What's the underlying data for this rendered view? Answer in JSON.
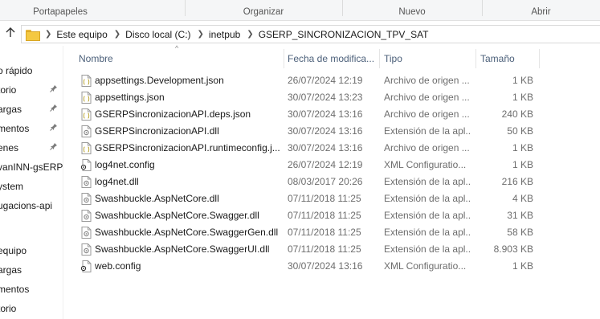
{
  "ribbon": {
    "groups": [
      "Portapapeles",
      "Organizar",
      "Nuevo",
      "Abrir"
    ]
  },
  "address": {
    "breadcrumbs": [
      "Este equipo",
      "Disco local (C:)",
      "inetpub",
      "GSERP_SINCRONIZACION_TPV_SAT"
    ]
  },
  "nav": {
    "items": [
      {
        "label": "o rápido",
        "pinned": false
      },
      {
        "label": "torio",
        "pinned": true
      },
      {
        "label": "argas",
        "pinned": true
      },
      {
        "label": "mentos",
        "pinned": true
      },
      {
        "label": "enes",
        "pinned": true
      },
      {
        "label": "vanINN-gsERP",
        "pinned": false
      },
      {
        "label": "ystem",
        "pinned": false
      },
      {
        "label": "ugacions-api",
        "pinned": false
      },
      {
        "label": "",
        "pinned": false
      },
      {
        "label": "equipo",
        "pinned": false
      },
      {
        "label": "argas",
        "pinned": false
      },
      {
        "label": "mentos",
        "pinned": false
      },
      {
        "label": "torio",
        "pinned": false
      }
    ]
  },
  "columns": {
    "name": "Nombre",
    "date": "Fecha de modifica...",
    "type": "Tipo",
    "size": "Tamaño"
  },
  "files": [
    {
      "name": "appsettings.Development.json",
      "date": "26/07/2024 12:19",
      "type": "Archivo de origen ...",
      "size": "1 KB",
      "icon": "json-file-icon"
    },
    {
      "name": "appsettings.json",
      "date": "30/07/2024 13:23",
      "type": "Archivo de origen ...",
      "size": "1 KB",
      "icon": "json-file-icon"
    },
    {
      "name": "GSERPSincronizacionAPI.deps.json",
      "date": "30/07/2024 13:16",
      "type": "Archivo de origen ...",
      "size": "240 KB",
      "icon": "json-file-icon"
    },
    {
      "name": "GSERPSincronizacionAPI.dll",
      "date": "30/07/2024 13:16",
      "type": "Extensión de la apl...",
      "size": "50 KB",
      "icon": "dll-file-icon"
    },
    {
      "name": "GSERPSincronizacionAPI.runtimeconfig.j...",
      "date": "30/07/2024 13:16",
      "type": "Archivo de origen ...",
      "size": "1 KB",
      "icon": "json-file-icon"
    },
    {
      "name": "log4net.config",
      "date": "26/07/2024 12:19",
      "type": "XML Configuratio...",
      "size": "1 KB",
      "icon": "config-file-icon"
    },
    {
      "name": "log4net.dll",
      "date": "08/03/2017 20:26",
      "type": "Extensión de la apl...",
      "size": "216 KB",
      "icon": "dll-file-icon"
    },
    {
      "name": "Swashbuckle.AspNetCore.dll",
      "date": "07/11/2018 11:25",
      "type": "Extensión de la apl...",
      "size": "4 KB",
      "icon": "dll-file-icon"
    },
    {
      "name": "Swashbuckle.AspNetCore.Swagger.dll",
      "date": "07/11/2018 11:25",
      "type": "Extensión de la apl...",
      "size": "31 KB",
      "icon": "dll-file-icon"
    },
    {
      "name": "Swashbuckle.AspNetCore.SwaggerGen.dll",
      "date": "07/11/2018 11:25",
      "type": "Extensión de la apl...",
      "size": "58 KB",
      "icon": "dll-file-icon"
    },
    {
      "name": "Swashbuckle.AspNetCore.SwaggerUI.dll",
      "date": "07/11/2018 11:25",
      "type": "Extensión de la apl...",
      "size": "8.903 KB",
      "icon": "dll-file-icon"
    },
    {
      "name": "web.config",
      "date": "30/07/2024 13:16",
      "type": "XML Configuratio...",
      "size": "1 KB",
      "icon": "config-file-icon"
    }
  ]
}
